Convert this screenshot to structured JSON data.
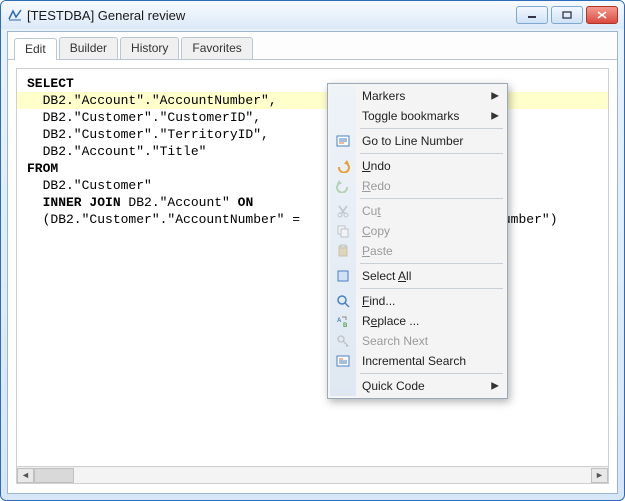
{
  "window": {
    "title": "[TESTDBA] General review"
  },
  "tabs": [
    {
      "label": "Edit",
      "active": true
    },
    {
      "label": "Builder",
      "active": false
    },
    {
      "label": "History",
      "active": false
    },
    {
      "label": "Favorites",
      "active": false
    }
  ],
  "code": {
    "line1": "SELECT",
    "line2": "  DB2.\"Account\".\"AccountNumber\",",
    "line3": "  DB2.\"Customer\".\"CustomerID\",",
    "line4": "  DB2.\"Customer\".\"TerritoryID\",",
    "line5": "  DB2.\"Account\".\"Title\"",
    "line6": "FROM",
    "line7": "  DB2.\"Customer\"",
    "line8_pre": "  INNER JOIN",
    "line8_mid": " DB2.\"Account\" ",
    "line8_on": "ON",
    "line9_visible_left": "  (DB2.\"Customer\".\"AccountNumber\" =",
    "line9_visible_right": "ountNumber\")"
  },
  "contextMenu": {
    "markers": "Markers",
    "toggleBookmarks": "Toggle bookmarks",
    "gotoLine": "Go to Line Number",
    "undo": "Undo",
    "redo": "Redo",
    "cut": "Cut",
    "copy": "Copy",
    "paste": "Paste",
    "selectAll": "Select All",
    "find": "Find...",
    "replace": "Replace ...",
    "searchNext": "Search Next",
    "incrementalSearch": "Incremental Search",
    "quickCode": "Quick Code"
  }
}
